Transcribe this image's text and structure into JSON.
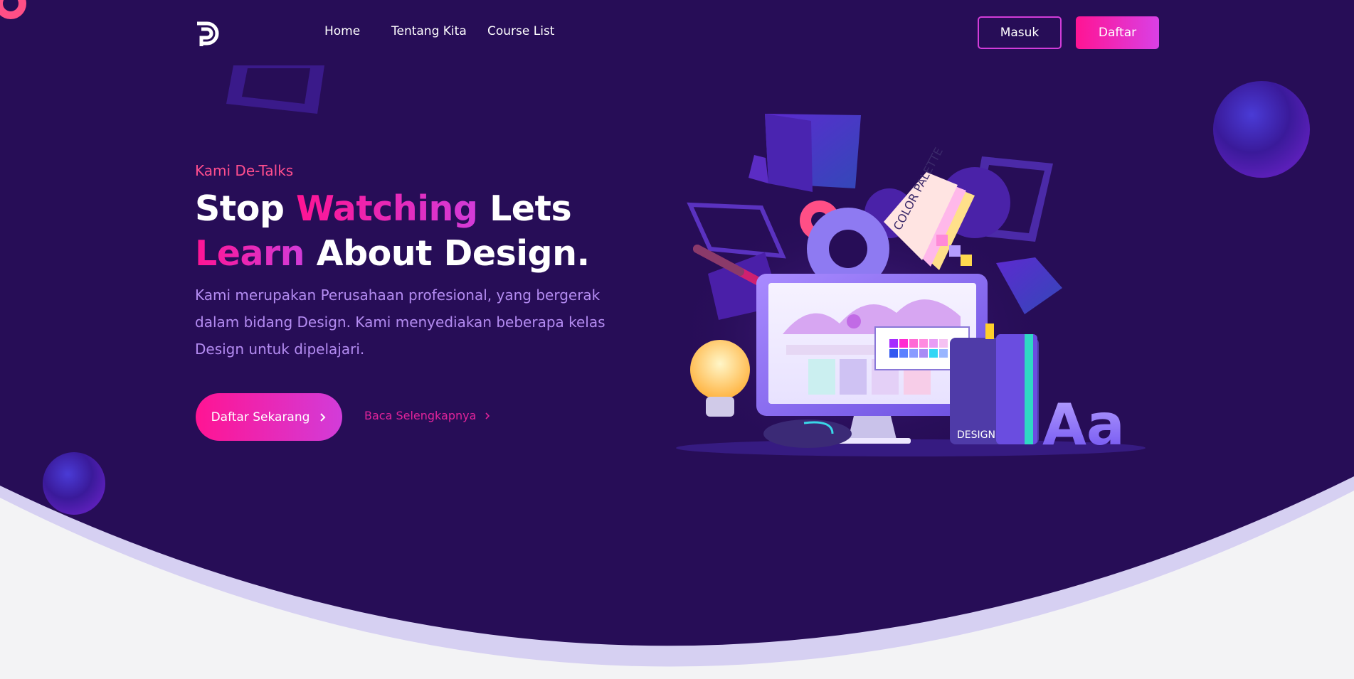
{
  "nav": {
    "links": [
      "Home",
      "Tentang Kita",
      "Course List"
    ],
    "login_label": "Masuk",
    "register_label": "Daftar"
  },
  "hero": {
    "eyebrow": "Kami De-Talks",
    "headline": {
      "w1": "Stop",
      "w2": "Watching",
      "w3": "Lets",
      "w4": "Learn",
      "w5": "About Design."
    },
    "description": "Kami merupakan Perusahaan profesional, yang bergerak dalam bidang Design. Kami menyediakan beberapa kelas Design untuk dipelajari.",
    "cta_label": "Daftar Sekarang",
    "read_more_label": "Baca Selengkapnya"
  },
  "illustration": {
    "palette_label": "COLOR PALETTE",
    "book_label": "DESIGN",
    "letters": "Aa"
  },
  "colors": {
    "bg_dark": "#270d57",
    "accent_pink": "#ff1493",
    "accent_purple": "#d23cd9",
    "text_lavender": "#b48cf2",
    "wave_light": "#d6d0f2",
    "page_bg": "#f3f3f5"
  }
}
